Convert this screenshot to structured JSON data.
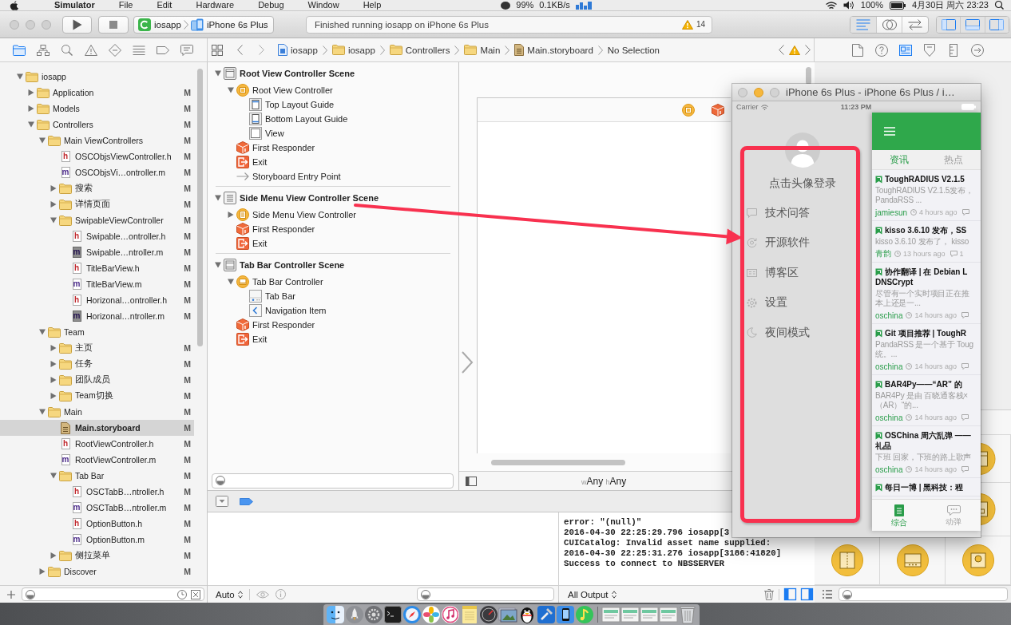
{
  "menu_bar": {
    "app_name": "Simulator",
    "menus": [
      "File",
      "Edit",
      "Hardware",
      "Debug",
      "Window",
      "Help"
    ],
    "status_texts": [
      "99%",
      "0.1KB/s",
      "100%",
      "4月30日 周六 23:23"
    ]
  },
  "toolbar": {
    "scheme_target": "iosapp",
    "scheme_device": "iPhone 6s Plus",
    "activity_message": "Finished running iosapp on iPhone 6s Plus",
    "warning_count": "14",
    "editor_modes": [
      {
        "kind": "standard",
        "selected": true
      },
      {
        "kind": "assistant",
        "selected": false
      },
      {
        "kind": "version",
        "selected": false
      }
    ],
    "panels": [
      {
        "kind": "navigator",
        "on": true
      },
      {
        "kind": "debug",
        "on": true
      },
      {
        "kind": "utilities",
        "on": true
      }
    ]
  },
  "navigator_tabs": [
    {
      "kind": "project",
      "selected": true
    },
    {
      "kind": "symbol",
      "selected": false
    },
    {
      "kind": "find",
      "selected": false
    },
    {
      "kind": "issue",
      "selected": false
    },
    {
      "kind": "test",
      "selected": false
    },
    {
      "kind": "debug",
      "selected": false
    },
    {
      "kind": "breakpoint",
      "selected": false
    },
    {
      "kind": "report",
      "selected": false
    }
  ],
  "jump_bar": {
    "path": [
      {
        "label": "iosapp",
        "kind": "project"
      },
      {
        "label": "iosapp",
        "kind": "folder"
      },
      {
        "label": "Controllers",
        "kind": "folder"
      },
      {
        "label": "Main",
        "kind": "folder"
      },
      {
        "label": "Main.storyboard",
        "kind": "storyboard"
      },
      {
        "label": "No Selection",
        "kind": "none"
      }
    ]
  },
  "inspector_tabs": [
    {
      "kind": "file",
      "selected": false
    },
    {
      "kind": "help",
      "selected": false
    },
    {
      "kind": "identity",
      "selected": true
    },
    {
      "kind": "attributes",
      "selected": false
    },
    {
      "kind": "size",
      "selected": false
    },
    {
      "kind": "connections",
      "selected": false
    }
  ],
  "project_tree": [
    {
      "name": "iosapp",
      "kind": "folder",
      "expanded": true,
      "selected": false,
      "children": [
        {
          "name": "Application",
          "kind": "folder",
          "expanded": false,
          "selected": false,
          "status": "M"
        },
        {
          "name": "Models",
          "kind": "folder",
          "expanded": false,
          "selected": false,
          "status": "M"
        },
        {
          "name": "Controllers",
          "kind": "folder",
          "expanded": true,
          "selected": false,
          "status": "M",
          "children": [
            {
              "name": "Main ViewControllers",
              "kind": "folder",
              "expanded": true,
              "selected": false,
              "status": "M",
              "children": [
                {
                  "name": "OSCObjsViewController.h",
                  "kind": "file",
                  "ext": "h",
                  "shaded": false,
                  "selected": false,
                  "status": "M"
                },
                {
                  "name": "OSCObjsVi…ontroller.m",
                  "kind": "file",
                  "ext": "m",
                  "shaded": false,
                  "selected": false,
                  "status": "M"
                },
                {
                  "name": "搜索",
                  "kind": "folder",
                  "expanded": false,
                  "selected": false,
                  "status": "M"
                },
                {
                  "name": "详情页面",
                  "kind": "folder",
                  "expanded": false,
                  "selected": false,
                  "status": "M"
                },
                {
                  "name": "SwipableViewController",
                  "kind": "folder",
                  "expanded": true,
                  "selected": false,
                  "status": "M",
                  "children": [
                    {
                      "name": "Swipable…ontroller.h",
                      "kind": "file",
                      "ext": "h",
                      "shaded": false,
                      "selected": false,
                      "status": "M"
                    },
                    {
                      "name": "Swipable…ntroller.m",
                      "kind": "file",
                      "ext": "m",
                      "shaded": true,
                      "selected": false,
                      "status": "M"
                    },
                    {
                      "name": "TitleBarView.h",
                      "kind": "file",
                      "ext": "h",
                      "shaded": false,
                      "selected": false,
                      "status": "M"
                    },
                    {
                      "name": "TitleBarView.m",
                      "kind": "file",
                      "ext": "m",
                      "shaded": false,
                      "selected": false,
                      "status": "M"
                    },
                    {
                      "name": "Horizonal…ontroller.h",
                      "kind": "file",
                      "ext": "h",
                      "shaded": false,
                      "selected": false,
                      "status": "M"
                    },
                    {
                      "name": "Horizonal…ntroller.m",
                      "kind": "file",
                      "ext": "m",
                      "shaded": true,
                      "selected": false,
                      "status": "M"
                    }
                  ]
                }
              ]
            },
            {
              "name": "Team",
              "kind": "folder",
              "expanded": true,
              "selected": false,
              "children": [
                {
                  "name": "主页",
                  "kind": "folder",
                  "expanded": false,
                  "selected": false,
                  "status": "M"
                },
                {
                  "name": "任务",
                  "kind": "folder",
                  "expanded": false,
                  "selected": false,
                  "status": "M"
                },
                {
                  "name": "团队成员",
                  "kind": "folder",
                  "expanded": false,
                  "selected": false,
                  "status": "M"
                },
                {
                  "name": "Team切换",
                  "kind": "folder",
                  "expanded": false,
                  "selected": false,
                  "status": "M"
                }
              ]
            },
            {
              "name": "Main",
              "kind": "folder",
              "expanded": true,
              "selected": false,
              "status": "M",
              "children": [
                {
                  "name": "Main.storyboard",
                  "kind": "storyboard",
                  "selected": true,
                  "status": "M"
                },
                {
                  "name": "RootViewController.h",
                  "kind": "file",
                  "ext": "h",
                  "shaded": false,
                  "selected": false,
                  "status": "M"
                },
                {
                  "name": "RootViewController.m",
                  "kind": "file",
                  "ext": "m",
                  "shaded": false,
                  "selected": false,
                  "status": "M"
                },
                {
                  "name": "Tab Bar",
                  "kind": "folder",
                  "expanded": true,
                  "selected": false,
                  "status": "M",
                  "children": [
                    {
                      "name": "OSCTabB…ntroller.h",
                      "kind": "file",
                      "ext": "h",
                      "shaded": false,
                      "selected": false,
                      "status": "M"
                    },
                    {
                      "name": "OSCTabB…ntroller.m",
                      "kind": "file",
                      "ext": "m",
                      "shaded": false,
                      "selected": false,
                      "status": "M"
                    },
                    {
                      "name": "OptionButton.h",
                      "kind": "file",
                      "ext": "h",
                      "shaded": false,
                      "selected": false,
                      "status": "M"
                    },
                    {
                      "name": "OptionButton.m",
                      "kind": "file",
                      "ext": "m",
                      "shaded": false,
                      "selected": false,
                      "status": "M"
                    }
                  ]
                },
                {
                  "name": "侧拉菜单",
                  "kind": "folder",
                  "expanded": false,
                  "selected": false,
                  "status": "M"
                }
              ]
            },
            {
              "name": "Discover",
              "kind": "folder",
              "expanded": false,
              "selected": false,
              "status": "M"
            }
          ]
        }
      ]
    }
  ],
  "document_outline": [
    {
      "title": "Root View Controller Scene",
      "kind": "window",
      "expanded": true,
      "items": [
        {
          "label": "Root View Controller",
          "kind": "controller",
          "expanded": true,
          "children": [
            {
              "label": "Top Layout Guide",
              "kind": "top-guide"
            },
            {
              "label": "Bottom Layout Guide",
              "kind": "bottom-guide"
            },
            {
              "label": "View",
              "kind": "view"
            }
          ]
        },
        {
          "label": "First Responder",
          "kind": "responder"
        },
        {
          "label": "Exit",
          "kind": "exit"
        },
        {
          "label": "Storyboard Entry Point",
          "kind": "entry"
        }
      ]
    },
    {
      "title": "Side Menu View Controller Scene",
      "kind": "list",
      "expanded": true,
      "items": [
        {
          "label": "Side Menu View Controller",
          "kind": "menu-controller",
          "expanded": false
        },
        {
          "label": "First Responder",
          "kind": "responder"
        },
        {
          "label": "Exit",
          "kind": "exit"
        }
      ]
    },
    {
      "title": "Tab Bar Controller Scene",
      "kind": "tabs",
      "expanded": true,
      "items": [
        {
          "label": "Tab Bar Controller",
          "kind": "tab-controller",
          "expanded": true,
          "children": [
            {
              "label": "Tab Bar",
              "kind": "tab-bar"
            },
            {
              "label": "Navigation Item",
              "kind": "nav-item"
            }
          ]
        },
        {
          "label": "First Responder",
          "kind": "responder"
        },
        {
          "label": "Exit",
          "kind": "exit"
        }
      ]
    }
  ],
  "canvas": {
    "size_class": {
      "width_prefix": "w",
      "width": "Any",
      "height_prefix": "h",
      "height": "Any"
    }
  },
  "debug_area": {
    "breakpoints_active": true,
    "variables_scope": "Auto",
    "console_filter": "All Output",
    "panes": [
      {
        "kind": "variables",
        "on": true
      },
      {
        "kind": "console",
        "on": true
      }
    ],
    "console_lines": [
      "error: \"(null)\"",
      "2016-04-30 22:25:29.796 iosapp[3",
      "CUICatalog: Invalid asset name supplied:",
      "2016-04-30 22:25:31.276 iosapp[3186:41820]",
      "Success to connect to NBSSERVER"
    ]
  },
  "simulator": {
    "title": "iPhone 6s Plus - iPhone 6s Plus / i…",
    "carrier": "Carrier",
    "time": "11:23 PM",
    "drawer": {
      "login_prompt": "点击头像登录",
      "items": [
        {
          "label": "技术问答",
          "kind": "chat"
        },
        {
          "label": "开源软件",
          "kind": "software"
        },
        {
          "label": "博客区",
          "kind": "blog"
        },
        {
          "label": "设置",
          "kind": "settings"
        },
        {
          "label": "夜间模式",
          "kind": "night"
        }
      ]
    },
    "app": {
      "tabs": [
        {
          "label": "资讯",
          "selected": true
        },
        {
          "label": "热点",
          "selected": false
        }
      ],
      "news": [
        {
          "title_lines": [
            "ToughRADIUS V2.1.5"
          ],
          "summary_lines": [
            "ToughRADIUS V2.1.5发布，",
            "PandaRSS ..."
          ],
          "author": "jamiesun",
          "time": "4 hours ago"
        },
        {
          "title_lines": [
            "kisso 3.6.10 发布，SS"
          ],
          "summary_lines": [
            "kisso 3.6.10 发布了， kisso"
          ],
          "author": "青韵",
          "time": "13 hours ago",
          "comments": "1"
        },
        {
          "title_lines": [
            "协作翻译 | 在 Debian L",
            "DNSCrypt"
          ],
          "summary_lines": [
            "尽管有一个实时项目正在推",
            "本上还是一..."
          ],
          "author": "oschina",
          "time": "14 hours ago"
        },
        {
          "title_lines": [
            "Git 项目推荐 | ToughR"
          ],
          "summary_lines": [
            "PandaRSS 是一个基于 Toug",
            "统。..."
          ],
          "author": "oschina",
          "time": "14 hours ago"
        },
        {
          "title_lines": [
            "BAR4Py——“AR” 的"
          ],
          "summary_lines": [
            "BAR4Py 是由 百晓通客栈×",
            "（AR）“的..."
          ],
          "author": "oschina",
          "time": "14 hours ago"
        },
        {
          "title_lines": [
            "OSChina 周六乱弹 ——",
            "礼品"
          ],
          "summary_lines": [
            "下班 回家，下班的路上歌声"
          ],
          "author": "oschina",
          "time": "14 hours ago"
        },
        {
          "title_lines": [
            "每日一博 | 黑科技：程"
          ]
        }
      ],
      "bottom_tabs": [
        {
          "label": "综合",
          "kind": "feed",
          "selected": true
        },
        {
          "label": "动弹",
          "kind": "chat",
          "selected": false
        }
      ]
    }
  }
}
